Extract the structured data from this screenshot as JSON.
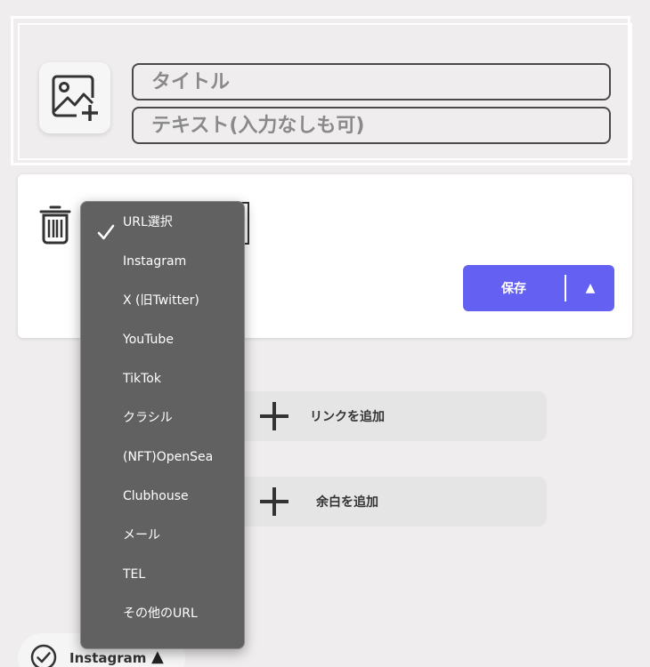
{
  "header": {
    "title_placeholder": "タイトル",
    "text_placeholder": "テキスト(入力なしも可)",
    "image_icon": "image-add-icon"
  },
  "link_card": {
    "trash_icon": "trash-icon",
    "save_label": "保存",
    "save_arrow": "▲",
    "accent_color": "#6461f2"
  },
  "dropdown": {
    "selected_index": 0,
    "items": [
      "URL選択",
      "Instagram",
      "X (旧Twitter)",
      "YouTube",
      "TikTok",
      "クラシル",
      "(NFT)OpenSea",
      "Clubhouse",
      "メール",
      "TEL",
      "その他のURL"
    ]
  },
  "actions": {
    "add_link_label": "リンクを追加",
    "add_space_label": "余白を追加"
  },
  "bottom_chip": {
    "label": "Instagram",
    "arrow": "▲"
  }
}
